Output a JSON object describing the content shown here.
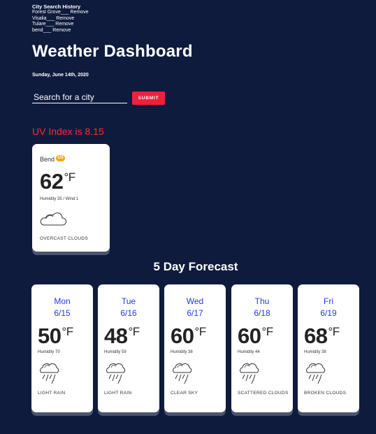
{
  "history": {
    "title": "City Search History",
    "items": [
      {
        "city": "Forest Grove___",
        "remove": "Remove"
      },
      {
        "city": "Visalia___",
        "remove": "Remove"
      },
      {
        "city": "Tulare___",
        "remove": "Remove"
      },
      {
        "city": "bend___",
        "remove": "Remove"
      }
    ]
  },
  "header": {
    "title": "Weather Dashboard",
    "date": "Sunday, June 14th, 2020"
  },
  "search": {
    "placeholder": "Search for a city",
    "value": "",
    "submit_label": "SUBMIT"
  },
  "uv": {
    "text": "UV Index is 8.15"
  },
  "current": {
    "city": "Bend",
    "country": "US",
    "temp": "62",
    "unit": "°F",
    "details": "Humidity 35 / Wind 1",
    "icon": "cloud-icon",
    "description": "OVERCAST CLOUDS"
  },
  "forecast": {
    "title": "5 Day Forecast",
    "days": [
      {
        "day": "Mon",
        "date": "6/15",
        "temp": "50",
        "unit": "°F",
        "humidity": "Humidity 70",
        "icon": "rain-cloud-icon",
        "description": "LIGHT RAIN"
      },
      {
        "day": "Tue",
        "date": "6/16",
        "temp": "48",
        "unit": "°F",
        "humidity": "Humidity 59",
        "icon": "rain-cloud-icon",
        "description": "LIGHT RAIN"
      },
      {
        "day": "Wed",
        "date": "6/17",
        "temp": "60",
        "unit": "°F",
        "humidity": "Humidity 38",
        "icon": "rain-cloud-icon",
        "description": "CLEAR SKY"
      },
      {
        "day": "Thu",
        "date": "6/18",
        "temp": "60",
        "unit": "°F",
        "humidity": "Humidity 44",
        "icon": "rain-cloud-icon",
        "description": "SCATTERED CLOUDS"
      },
      {
        "day": "Fri",
        "date": "6/19",
        "temp": "68",
        "unit": "°F",
        "humidity": "Humidity 38",
        "icon": "rain-cloud-icon",
        "description": "BROKEN CLOUDS"
      }
    ]
  },
  "colors": {
    "background": "#0e1b3d",
    "accent": "#f0203d",
    "uv_text": "#ff2b2b",
    "forecast_day": "#1f39f0",
    "country_badge": "#f4a51c"
  }
}
